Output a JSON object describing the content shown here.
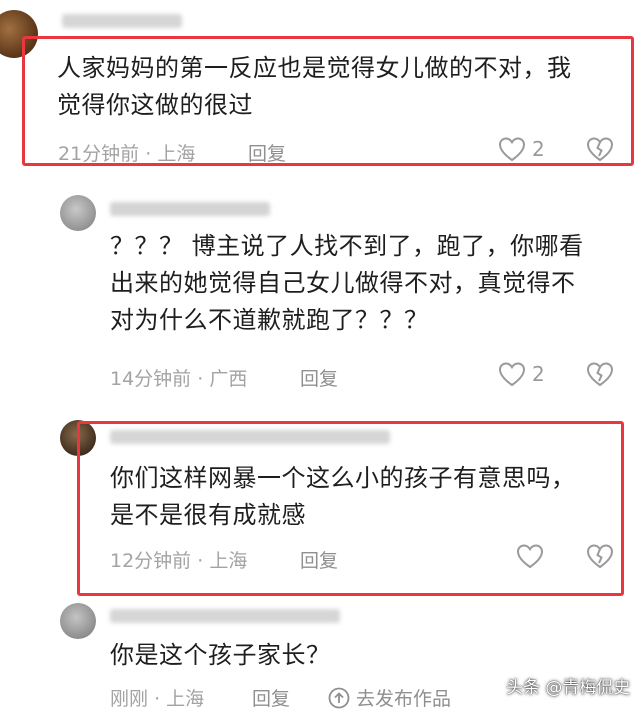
{
  "comments": [
    {
      "text_lines": [
        "人家妈妈的第一反应也是觉得女儿做的不对，我",
        "觉得你这做的很过"
      ],
      "time": "21分钟前",
      "location": "上海",
      "reply_label": "回复",
      "like_count": "2"
    },
    {
      "text_lines": [
        "？？？ 博主说了人找不到了，跑了，你哪看",
        "出来的她觉得自己女儿做得不对，真觉得不",
        "对为什么不道歉就跑了？？？"
      ],
      "time": "14分钟前",
      "location": "广西",
      "reply_label": "回复",
      "like_count": "2"
    },
    {
      "text_lines": [
        "你们这样网暴一个这么小的孩子有意思吗，",
        "是不是很有成就感"
      ],
      "time": "12分钟前",
      "location": "上海",
      "reply_label": "回复",
      "like_count": ""
    },
    {
      "text_lines": [
        "你是这个孩子家长？"
      ],
      "time": "刚刚",
      "location": "上海",
      "reply_label": "回复",
      "share_label": "去发布作品"
    }
  ],
  "separator": "·",
  "watermark": "头条 @青梅侃史",
  "colors": {
    "highlight_border": "#e8373f",
    "meta_text": "#a3a3a3"
  },
  "icons": {
    "like": "heart-icon",
    "dislike": "broken-heart-icon",
    "share": "upload-arrow-icon"
  }
}
